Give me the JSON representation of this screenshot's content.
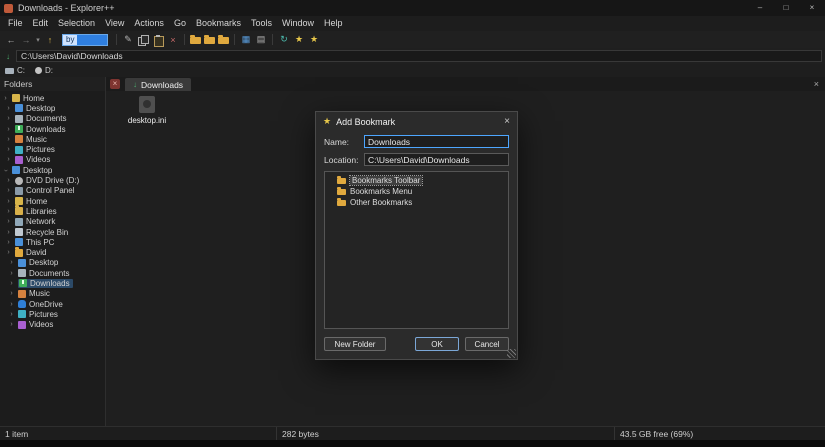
{
  "window": {
    "title": "Downloads - Explorer++"
  },
  "icons": {
    "minimize": "–",
    "maximize": "□",
    "close": "×",
    "back": "←",
    "forward": "→",
    "dropdown": "▾",
    "up": "↑",
    "rename": "✎",
    "delete": "×",
    "views": "▦",
    "details": "▤",
    "refresh": "↻",
    "star": "★",
    "chevron": "›",
    "download_arrow": "↓"
  },
  "menubar": {
    "items": [
      "File",
      "Edit",
      "Selection",
      "View",
      "Actions",
      "Go",
      "Bookmarks",
      "Tools",
      "Window",
      "Help"
    ]
  },
  "toolbar": {
    "edit_text": "by"
  },
  "addressbar": {
    "path": "C:\\Users\\David\\Downloads"
  },
  "drivebar": {
    "drives": [
      {
        "label": "C:"
      },
      {
        "label": "D:"
      }
    ]
  },
  "folders_pane": {
    "header": "Folders"
  },
  "tabstrip": {
    "active_tab": "Downloads"
  },
  "tree": {
    "items": [
      {
        "label": "Home",
        "icon": "home-icon"
      },
      {
        "label": "Desktop",
        "icon": "desktop-icon"
      },
      {
        "label": "Documents",
        "icon": "documents-icon"
      },
      {
        "label": "Downloads",
        "icon": "downloads-icon"
      },
      {
        "label": "Music",
        "icon": "music-icon"
      },
      {
        "label": "Pictures",
        "icon": "pictures-icon"
      },
      {
        "label": "Videos",
        "icon": "videos-icon"
      },
      {
        "label": "Desktop",
        "icon": "desktop-icon"
      },
      {
        "label": "DVD Drive (D:)",
        "icon": "dvd-icon"
      },
      {
        "label": "Control Panel",
        "icon": "control-panel-icon"
      },
      {
        "label": "Home",
        "icon": "home-icon"
      },
      {
        "label": "Libraries",
        "icon": "libraries-icon"
      },
      {
        "label": "Network",
        "icon": "network-icon"
      },
      {
        "label": "Recycle Bin",
        "icon": "recycle-bin-icon"
      },
      {
        "label": "This PC",
        "icon": "this-pc-icon"
      },
      {
        "label": "David",
        "icon": "folder-icon"
      },
      {
        "label": "Desktop",
        "icon": "desktop-icon"
      },
      {
        "label": "Documents",
        "icon": "documents-icon"
      },
      {
        "label": "Downloads",
        "icon": "downloads-icon",
        "selected": true
      },
      {
        "label": "Music",
        "icon": "music-icon"
      },
      {
        "label": "OneDrive",
        "icon": "onedrive-icon"
      },
      {
        "label": "Pictures",
        "icon": "pictures-icon"
      },
      {
        "label": "Videos",
        "icon": "videos-icon"
      }
    ]
  },
  "content": {
    "files": [
      {
        "name": "desktop.ini",
        "icon": "ini-file-icon"
      }
    ]
  },
  "dialog": {
    "title": "Add Bookmark",
    "name_label": "Name:",
    "name_value": "Downloads",
    "location_label": "Location:",
    "location_value": "C:\\Users\\David\\Downloads",
    "folder_tree": [
      {
        "label": "Bookmarks Toolbar",
        "selected": true
      },
      {
        "label": "Bookmarks Menu"
      },
      {
        "label": "Other Bookmarks"
      }
    ],
    "new_folder_button": "New Folder",
    "ok_button": "OK",
    "cancel_button": "Cancel"
  },
  "statusbar": {
    "items_count": "1 item",
    "selection_size": "282 bytes",
    "free_space": "43.5 GB free (69%)"
  }
}
